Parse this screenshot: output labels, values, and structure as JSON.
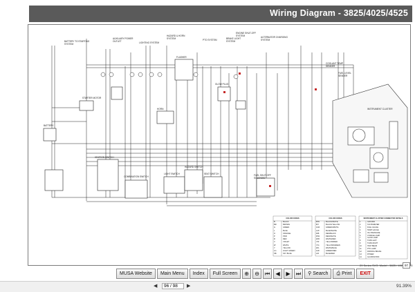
{
  "document": {
    "title": "Wiring Diagram - 3825/4025/4525",
    "footnote": "29 Series SVG. Model - 3825 / 4025 / 4525",
    "page_badge": "97"
  },
  "diagram": {
    "labels": {
      "battery_to_starting_system": "BATTERY TO STARTING SYSTEM",
      "aux_power_outlet": "AUXILIARY POWER OUTLET",
      "lighting_system": "LIGHTING SYSTEM",
      "hazard_horn_system": "HAZARD & HORN SYSTEM",
      "pto_system": "PTO SYSTEM",
      "brake_light_system": "BRAKE LIGHT SYSTEM",
      "engine_shutoff": "ENGINE SHUT-OFF SYSTEM",
      "alternator": "ALTERNATOR CHARGING SYSTEM",
      "instrument_cluster": "INSTRUMENT CLUSTER",
      "fuel_level_sender": "FUEL LEVEL SENDER",
      "coolant_temp": "COOLANT TEMP SENDER",
      "starter_motor": "STARTER MOTOR",
      "battery": "BATTERY",
      "ignition_switch": "IGNITION SWITCH",
      "combination_switch": "COMBINATION SWITCH",
      "light_switch": "LIGHT SWITCH",
      "hazard_switch": "HAZARD SWITCH",
      "horn": "HORN",
      "flasher": "FLASHER",
      "seat_switch": "SEAT SWITCH",
      "fuel_shutoff": "FUEL SHUT-OFF SOLENOID",
      "glow_plug": "GLOW PLUG"
    },
    "color_codes_left": {
      "heading": "COLOR CODES",
      "rows": [
        [
          "B",
          "BLACK"
        ],
        [
          "BR",
          "BROWN"
        ],
        [
          "G",
          "GREEN"
        ],
        [
          "L",
          "BLUE"
        ],
        [
          "O",
          "ORANGE"
        ],
        [
          "P",
          "PINK"
        ],
        [
          "R",
          "RED"
        ],
        [
          "V",
          "VIOLET"
        ],
        [
          "W",
          "WHITE"
        ],
        [
          "Y",
          "YELLOW"
        ],
        [
          "LG",
          "LIGHT GREEN"
        ],
        [
          "SB",
          "SKY BLUE"
        ]
      ]
    },
    "color_codes_right": {
      "heading": "COLOR CODES",
      "rows": [
        [
          "B/W",
          "BLACK/WHITE"
        ],
        [
          "B/Y",
          "BLACK/YELLOW"
        ],
        [
          "G/W",
          "GREEN/WHITE"
        ],
        [
          "L/W",
          "BLUE/WHITE"
        ],
        [
          "R/B",
          "RED/BLACK"
        ],
        [
          "R/W",
          "RED/WHITE"
        ],
        [
          "W/R",
          "WHITE/RED"
        ],
        [
          "Y/R",
          "YELLOW/RED"
        ],
        [
          "Y/G",
          "YELLOW/GREEN"
        ],
        [
          "W/L",
          "WHITE/BLUE"
        ],
        [
          "G/R",
          "GREEN/RED"
        ],
        [
          "L/R",
          "BLUE/RED"
        ]
      ]
    },
    "cluster_details": {
      "heading": "INSTRUMENT CLUSTER CONNECTOR DETAILS",
      "rows": [
        [
          "1",
          "GROUND"
        ],
        [
          "2",
          "TACHOMETER"
        ],
        [
          "3",
          "FUEL GAUGE"
        ],
        [
          "4",
          "TEMP GAUGE"
        ],
        [
          "5",
          "OIL PRESSURE"
        ],
        [
          "6",
          "CHARGE LAMP"
        ],
        [
          "7",
          "GLOW LAMP"
        ],
        [
          "8",
          "TURN LEFT"
        ],
        [
          "9",
          "TURN RIGHT"
        ],
        [
          "10",
          "HIGH BEAM"
        ],
        [
          "11",
          "PTO LAMP"
        ],
        [
          "12",
          "PARKING BRAKE"
        ],
        [
          "13",
          "POWER"
        ],
        [
          "14",
          "ILLUMINATION"
        ]
      ]
    }
  },
  "toolbar": {
    "musa_website": "MUSA Website",
    "main_menu": "Main Menu",
    "index": "Index",
    "full_screen": "Full Screen",
    "search": "Search",
    "print": "Print",
    "exit": "EXIT"
  },
  "icons": {
    "zoom_in": "zoom-in-icon",
    "zoom_out": "zoom-out-icon",
    "first": "first-page-icon",
    "back": "back-icon",
    "forward": "forward-icon",
    "last": "last-page-icon",
    "search": "binoculars-icon",
    "print": "printer-icon"
  },
  "status": {
    "page_value": "96 / 98",
    "zoom": "91.39%"
  },
  "colors": {
    "title_bg": "#5a5a5a",
    "exit_red": "#c62828",
    "wire_red": "#c62828"
  }
}
